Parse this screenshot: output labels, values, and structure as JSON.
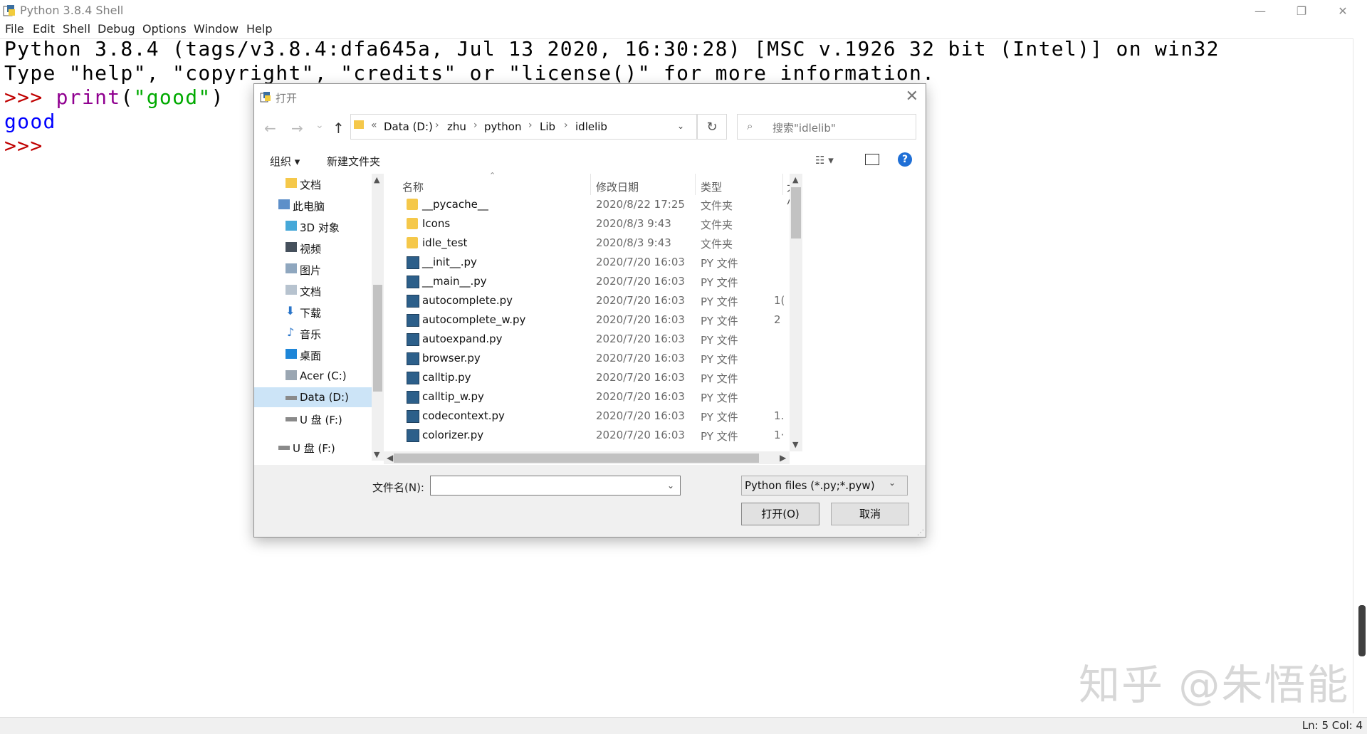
{
  "window": {
    "title": "Python 3.8.4 Shell",
    "minimize": "—",
    "maximize": "❐",
    "close": "✕"
  },
  "menu": [
    "File",
    "Edit",
    "Shell",
    "Debug",
    "Options",
    "Window",
    "Help"
  ],
  "shell": {
    "banner1": "Python 3.8.4 (tags/v3.8.4:dfa645a, Jul 13 2020, 16:30:28) [MSC v.1926 32 bit (Intel)] on win32",
    "banner2": "Type \"help\", \"copyright\", \"credits\" or \"license()\" for more information.",
    "prompt": ">>> ",
    "cmd_builtin": "print",
    "cmd_open": "(",
    "cmd_string": "\"good\"",
    "cmd_close": ")",
    "output": "good",
    "prompt2": ">>>"
  },
  "status": "Ln: 5  Col: 4",
  "watermark": "知乎 @朱悟能",
  "dialog": {
    "title": "打开",
    "close": "✕",
    "nav": {
      "back": "←",
      "forward": "→",
      "recent": "⌄",
      "up": "↑"
    },
    "breadcrumb_prefix": "«",
    "breadcrumb": [
      "Data (D:)",
      "zhu",
      "python",
      "Lib",
      "idlelib"
    ],
    "refresh": "↻",
    "search_placeholder": "搜索\"idlelib\"",
    "organize": "组织 ▾",
    "new_folder": "新建文件夹",
    "help": "?",
    "view_toggle": "☷ ▾",
    "tree": [
      {
        "label": "文档",
        "icon": "folder-icon",
        "indent": 1
      },
      {
        "label": "此电脑",
        "icon": "computer-icon",
        "indent": 0
      },
      {
        "label": "3D 对象",
        "icon": "3d-objects-icon",
        "indent": 1
      },
      {
        "label": "视频",
        "icon": "video-icon",
        "indent": 1
      },
      {
        "label": "图片",
        "icon": "pictures-icon",
        "indent": 1
      },
      {
        "label": "文档",
        "icon": "documents-icon",
        "indent": 1
      },
      {
        "label": "下载",
        "icon": "download-icon",
        "indent": 1
      },
      {
        "label": "音乐",
        "icon": "music-icon",
        "indent": 1
      },
      {
        "label": "桌面",
        "icon": "desktop-icon",
        "indent": 1
      },
      {
        "label": "Acer (C:)",
        "icon": "drive-c-icon",
        "indent": 1
      },
      {
        "label": "Data (D:)",
        "icon": "drive-icon",
        "indent": 1,
        "selected": true
      },
      {
        "label": "U 盘 (F:)",
        "icon": "usb-drive-icon",
        "indent": 1
      },
      {
        "label": "U 盘 (F:)",
        "icon": "usb-drive-icon",
        "indent": 0
      }
    ],
    "columns": {
      "name": "名称",
      "date": "修改日期",
      "type": "类型",
      "size": "大小"
    },
    "files": [
      {
        "name": "__pycache__",
        "date": "2020/8/22 17:25",
        "type": "文件夹",
        "size": "",
        "kind": "folder"
      },
      {
        "name": "Icons",
        "date": "2020/8/3 9:43",
        "type": "文件夹",
        "size": "",
        "kind": "folder"
      },
      {
        "name": "idle_test",
        "date": "2020/8/3 9:43",
        "type": "文件夹",
        "size": "",
        "kind": "folder"
      },
      {
        "name": "__init__.py",
        "date": "2020/7/20 16:03",
        "type": "PY 文件",
        "size": "",
        "kind": "py"
      },
      {
        "name": "__main__.py",
        "date": "2020/7/20 16:03",
        "type": "PY 文件",
        "size": "",
        "kind": "py"
      },
      {
        "name": "autocomplete.py",
        "date": "2020/7/20 16:03",
        "type": "PY 文件",
        "size": "1(",
        "kind": "py"
      },
      {
        "name": "autocomplete_w.py",
        "date": "2020/7/20 16:03",
        "type": "PY 文件",
        "size": "2",
        "kind": "py"
      },
      {
        "name": "autoexpand.py",
        "date": "2020/7/20 16:03",
        "type": "PY 文件",
        "size": "",
        "kind": "py"
      },
      {
        "name": "browser.py",
        "date": "2020/7/20 16:03",
        "type": "PY 文件",
        "size": "",
        "kind": "py"
      },
      {
        "name": "calltip.py",
        "date": "2020/7/20 16:03",
        "type": "PY 文件",
        "size": "",
        "kind": "py"
      },
      {
        "name": "calltip_w.py",
        "date": "2020/7/20 16:03",
        "type": "PY 文件",
        "size": "",
        "kind": "py"
      },
      {
        "name": "codecontext.py",
        "date": "2020/7/20 16:03",
        "type": "PY 文件",
        "size": "1.",
        "kind": "py"
      },
      {
        "name": "colorizer.py",
        "date": "2020/7/20 16:03",
        "type": "PY 文件",
        "size": "1·",
        "kind": "py"
      }
    ],
    "filename_label": "文件名(N):",
    "filename_value": "",
    "filter": "Python files (*.py;*.pyw)",
    "open_button": "打开(O)",
    "cancel_button": "取消"
  }
}
